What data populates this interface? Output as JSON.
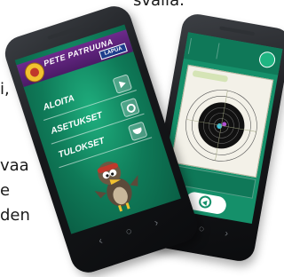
{
  "document_text": {
    "line1": "svalla.",
    "line2": "i,",
    "line3": "vaa",
    "line4": "e",
    "line5": "den"
  },
  "app": {
    "title": "PETE PATRUUNA",
    "brand": "LAPUA",
    "menu": [
      {
        "label": "ALOITA",
        "icon": "play-icon"
      },
      {
        "label": "ASETUKSET",
        "icon": "gear-icon"
      },
      {
        "label": "TULOKSET",
        "icon": "trophy-icon"
      }
    ]
  },
  "nav": {
    "back_glyph": "‹",
    "home_glyph": "○",
    "recent_glyph": "›"
  },
  "colors": {
    "screen_green": "#15906a",
    "header_purple": "#5a2178",
    "brand_blue": "#1d3c8c",
    "target_black": "#111111"
  }
}
